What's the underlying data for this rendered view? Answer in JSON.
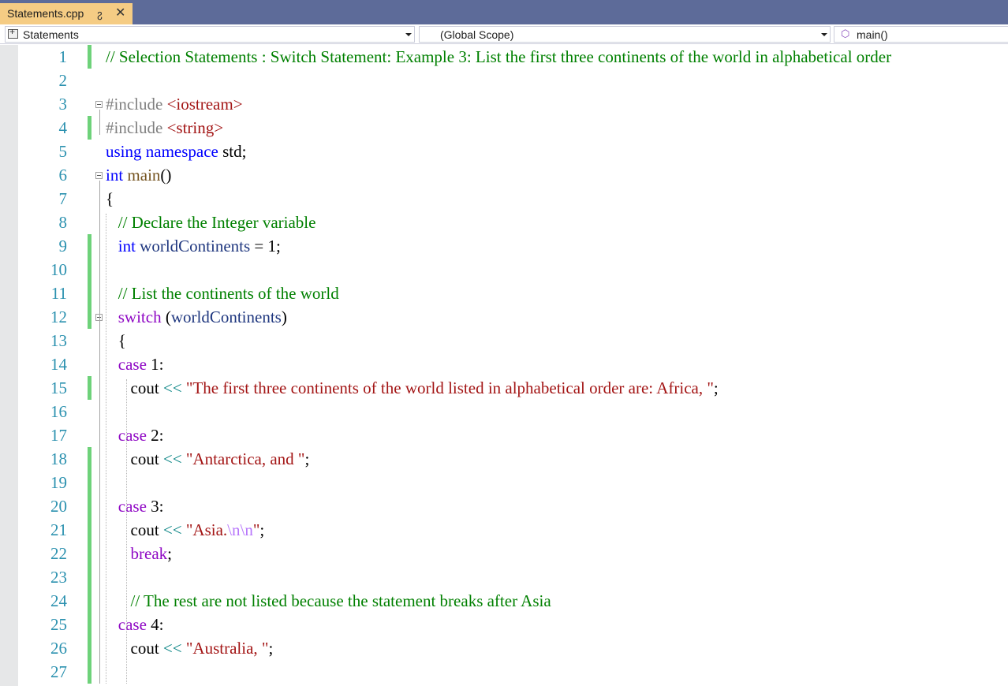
{
  "tab": {
    "title": "Statements.cpp",
    "pin_icon": "pin-icon",
    "close_icon": "close-icon"
  },
  "navbar": {
    "project": "Statements",
    "scope": "(Global Scope)",
    "member": "main()"
  },
  "lines": [
    {
      "n": "1",
      "tokens": [
        [
          "cm",
          "// Selection Statements : Switch Statement: Example 3: List the first three continents of the world in alphabetical order"
        ]
      ]
    },
    {
      "n": "2",
      "tokens": []
    },
    {
      "n": "3",
      "tokens": [
        [
          "pp",
          "#include "
        ],
        [
          "st",
          "<iostream>"
        ]
      ]
    },
    {
      "n": "4",
      "tokens": [
        [
          "pp",
          "#include "
        ],
        [
          "st",
          "<string>"
        ]
      ]
    },
    {
      "n": "5",
      "tokens": [
        [
          "kw",
          "using namespace "
        ],
        [
          "df",
          "std;"
        ]
      ]
    },
    {
      "n": "6",
      "tokens": [
        [
          "kw",
          "int "
        ],
        [
          "fn",
          "main"
        ],
        [
          "df",
          "()"
        ]
      ]
    },
    {
      "n": "7",
      "tokens": [
        [
          "df",
          "{"
        ]
      ]
    },
    {
      "n": "8",
      "tokens": [
        [
          "df",
          "   "
        ],
        [
          "cm",
          "// Declare the Integer variable"
        ]
      ]
    },
    {
      "n": "9",
      "tokens": [
        [
          "df",
          "   "
        ],
        [
          "kw",
          "int "
        ],
        [
          "var",
          "worldContinents"
        ],
        [
          "df",
          " = 1;"
        ]
      ]
    },
    {
      "n": "10",
      "tokens": []
    },
    {
      "n": "11",
      "tokens": [
        [
          "df",
          "   "
        ],
        [
          "cm",
          "// List the continents of the world"
        ]
      ]
    },
    {
      "n": "12",
      "tokens": [
        [
          "df",
          "   "
        ],
        [
          "ctl",
          "switch"
        ],
        [
          "df",
          " ("
        ],
        [
          "var",
          "worldContinents"
        ],
        [
          "df",
          ")"
        ]
      ]
    },
    {
      "n": "13",
      "tokens": [
        [
          "df",
          "   {"
        ]
      ]
    },
    {
      "n": "14",
      "tokens": [
        [
          "df",
          "   "
        ],
        [
          "ctl",
          "case"
        ],
        [
          "df",
          " 1:"
        ]
      ]
    },
    {
      "n": "15",
      "tokens": [
        [
          "df",
          "      cout "
        ],
        [
          "op",
          "<<"
        ],
        [
          "df",
          " "
        ],
        [
          "st",
          "\"The first three continents of the world listed in alphabetical order are: Africa, \""
        ],
        [
          "df",
          ";"
        ]
      ]
    },
    {
      "n": "16",
      "tokens": []
    },
    {
      "n": "17",
      "tokens": [
        [
          "df",
          "   "
        ],
        [
          "ctl",
          "case"
        ],
        [
          "df",
          " 2:"
        ]
      ]
    },
    {
      "n": "18",
      "tokens": [
        [
          "df",
          "      cout "
        ],
        [
          "op",
          "<<"
        ],
        [
          "df",
          " "
        ],
        [
          "st",
          "\"Antarctica, and \""
        ],
        [
          "df",
          ";"
        ]
      ]
    },
    {
      "n": "19",
      "tokens": []
    },
    {
      "n": "20",
      "tokens": [
        [
          "df",
          "   "
        ],
        [
          "ctl",
          "case"
        ],
        [
          "df",
          " 3:"
        ]
      ]
    },
    {
      "n": "21",
      "tokens": [
        [
          "df",
          "      cout "
        ],
        [
          "op",
          "<<"
        ],
        [
          "df",
          " "
        ],
        [
          "st",
          "\"Asia."
        ],
        [
          "esc",
          "\\n\\n"
        ],
        [
          "st",
          "\""
        ],
        [
          "df",
          ";"
        ]
      ]
    },
    {
      "n": "22",
      "tokens": [
        [
          "df",
          "      "
        ],
        [
          "ctl",
          "break"
        ],
        [
          "df",
          ";"
        ]
      ]
    },
    {
      "n": "23",
      "tokens": []
    },
    {
      "n": "24",
      "tokens": [
        [
          "df",
          "      "
        ],
        [
          "cm",
          "// The rest are not listed because the statement breaks after Asia"
        ]
      ]
    },
    {
      "n": "25",
      "tokens": [
        [
          "df",
          "   "
        ],
        [
          "ctl",
          "case"
        ],
        [
          "df",
          " 4:"
        ]
      ]
    },
    {
      "n": "26",
      "tokens": [
        [
          "df",
          "      cout "
        ],
        [
          "op",
          "<<"
        ],
        [
          "df",
          " "
        ],
        [
          "st",
          "\"Australia, \""
        ],
        [
          "df",
          ";"
        ]
      ]
    },
    {
      "n": "27",
      "tokens": []
    }
  ],
  "changed_lines": [
    1,
    4,
    9,
    10,
    11,
    12,
    15,
    18,
    19,
    20,
    21,
    22,
    23,
    24,
    25,
    26,
    27
  ],
  "fold_lines": [
    3,
    6,
    12
  ],
  "colors": {
    "tab_bg": "#f5cc84",
    "tabstrip_bg": "#5d6b99",
    "line_number": "#2b91af",
    "comment": "#008000",
    "keyword": "#0000ff",
    "control": "#8f08c4",
    "string": "#a31515",
    "variable": "#1f377f",
    "change_marker": "#6ed27a"
  }
}
